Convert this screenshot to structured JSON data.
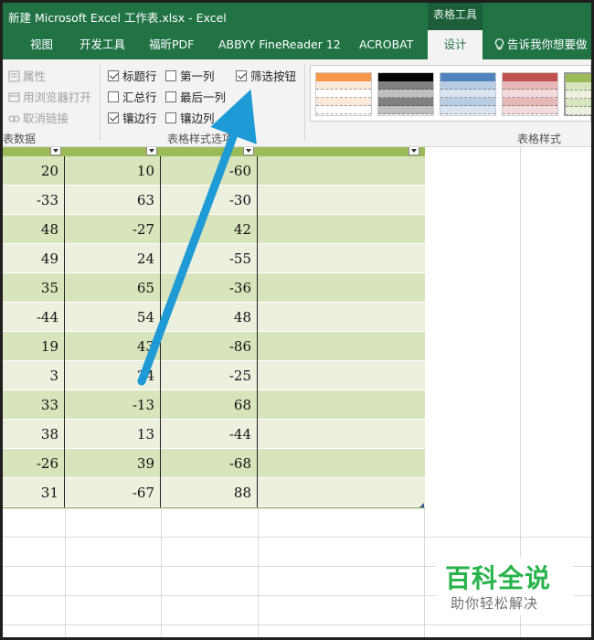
{
  "window": {
    "title": "新建 Microsoft Excel 工作表.xlsx  -  Excel",
    "context_tab": "表格工具"
  },
  "tabs": [
    {
      "label": "视图"
    },
    {
      "label": "开发工具"
    },
    {
      "label": "福昕PDF"
    },
    {
      "label": "ABBYY FineReader 12"
    },
    {
      "label": "ACROBAT"
    },
    {
      "label": "设计",
      "active": true
    }
  ],
  "tell_me": "告诉我你想要做",
  "ribbon": {
    "external_data": {
      "items": [
        "属性",
        "用浏览器打开",
        "取消链接"
      ],
      "label": "表数据"
    },
    "style_options": {
      "header_row": {
        "label": "标题行",
        "checked": true
      },
      "total_row": {
        "label": "汇总行",
        "checked": false
      },
      "banded_rows": {
        "label": "镶边行",
        "checked": true
      },
      "first_column": {
        "label": "第一列",
        "checked": false
      },
      "last_column": {
        "label": "最后一列",
        "checked": false
      },
      "banded_columns": {
        "label": "镶边列",
        "checked": false
      },
      "filter_button": {
        "label": "筛选按钮",
        "checked": true
      },
      "label": "表格样式选项"
    },
    "table_styles": {
      "label": "表格样式",
      "swatch_colors": [
        "#f79646",
        "#000000",
        "#4f81bd",
        "#c0504d",
        "#9bbb59"
      ]
    }
  },
  "table": {
    "header_partial": [
      "",
      "",
      "",
      ""
    ],
    "rows": [
      [
        "20",
        "10",
        "-60",
        ""
      ],
      [
        "-33",
        "63",
        "-30",
        ""
      ],
      [
        "48",
        "-27",
        "42",
        ""
      ],
      [
        "49",
        "24",
        "-55",
        ""
      ],
      [
        "35",
        "65",
        "-36",
        ""
      ],
      [
        "-44",
        "54",
        "48",
        ""
      ],
      [
        "19",
        "43",
        "-86",
        ""
      ],
      [
        "3",
        "24",
        "-25",
        ""
      ],
      [
        "33",
        "-13",
        "68",
        ""
      ],
      [
        "38",
        "13",
        "-44",
        ""
      ],
      [
        "-26",
        "39",
        "-68",
        ""
      ],
      [
        "31",
        "-67",
        "88",
        ""
      ]
    ]
  },
  "watermark": {
    "title": "百科全说",
    "subtitle": "助你轻松解决"
  },
  "colors": {
    "excel_green": "#217346",
    "header_green": "#9bbb59",
    "band_dark": "#d8e4bc",
    "band_light": "#ebf1de",
    "arrow_blue": "#1e9ad6"
  }
}
